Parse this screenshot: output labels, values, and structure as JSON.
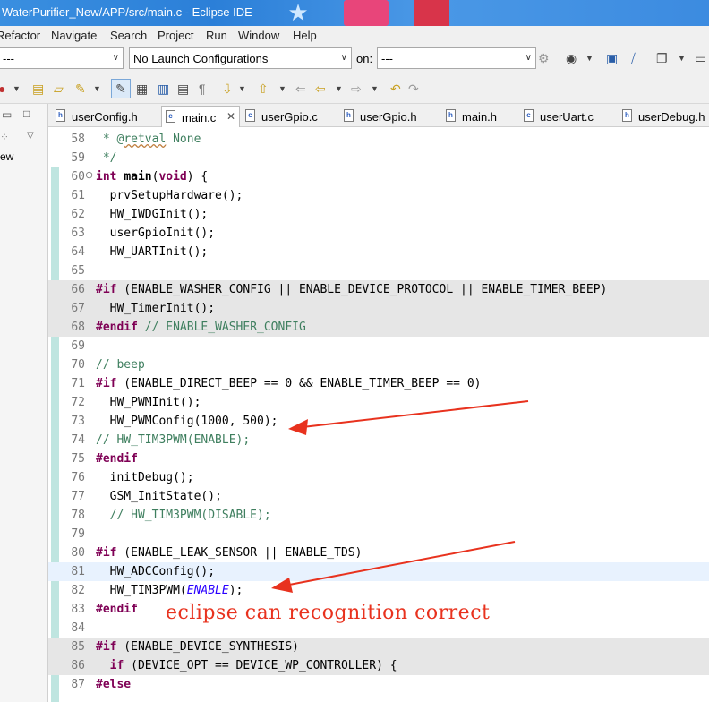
{
  "window": {
    "title": "WaterPurifier_New/APP/src/main.c - Eclipse IDE"
  },
  "menu": [
    "Refactor",
    "Navigate",
    "Search",
    "Project",
    "Run",
    "Window",
    "Help"
  ],
  "toolbar": {
    "launch_mode_value": "---",
    "launch_config_value": "No Launch Configurations",
    "on_label": "on:",
    "launch_target_value": "---"
  },
  "left_view": {
    "label": "ew"
  },
  "tabs": [
    {
      "label": "userConfig.h",
      "icon": "h-file-icon",
      "active": false
    },
    {
      "label": "main.c",
      "icon": "c-file-icon",
      "active": true
    },
    {
      "label": "userGpio.c",
      "icon": "c-file-icon",
      "active": false
    },
    {
      "label": "userGpio.h",
      "icon": "h-file-icon",
      "active": false
    },
    {
      "label": "main.h",
      "icon": "h-file-icon",
      "active": false
    },
    {
      "label": "userUart.c",
      "icon": "c-file-icon",
      "active": false
    },
    {
      "label": "userDebug.h",
      "icon": "h-file-icon",
      "active": false
    }
  ],
  "code_lines": [
    {
      "num": "58",
      "text": " * @retval None"
    },
    {
      "num": "59",
      "text": " */"
    },
    {
      "num": "60",
      "text": "int main(void) {"
    },
    {
      "num": "61",
      "text": "  prvSetupHardware();"
    },
    {
      "num": "62",
      "text": "  HW_IWDGInit();"
    },
    {
      "num": "63",
      "text": "  userGpioInit();"
    },
    {
      "num": "64",
      "text": "  HW_UARTInit();"
    },
    {
      "num": "65",
      "text": ""
    },
    {
      "num": "66",
      "text": "#if (ENABLE_WASHER_CONFIG || ENABLE_DEVICE_PROTOCOL || ENABLE_TIMER_BEEP)"
    },
    {
      "num": "67",
      "text": "  HW_TimerInit();"
    },
    {
      "num": "68",
      "text": "#endif // ENABLE_WASHER_CONFIG"
    },
    {
      "num": "69",
      "text": ""
    },
    {
      "num": "70",
      "text": "// beep"
    },
    {
      "num": "71",
      "text": "#if (ENABLE_DIRECT_BEEP == 0 && ENABLE_TIMER_BEEP == 0)"
    },
    {
      "num": "72",
      "text": "  HW_PWMInit();"
    },
    {
      "num": "73",
      "text": "  HW_PWMConfig(1000, 500);"
    },
    {
      "num": "74",
      "text": "// HW_TIM3PWM(ENABLE);"
    },
    {
      "num": "75",
      "text": "#endif"
    },
    {
      "num": "76",
      "text": "  initDebug();"
    },
    {
      "num": "77",
      "text": "  GSM_InitState();"
    },
    {
      "num": "78",
      "text": "  // HW_TIM3PWM(DISABLE);"
    },
    {
      "num": "79",
      "text": ""
    },
    {
      "num": "80",
      "text": "#if (ENABLE_LEAK_SENSOR || ENABLE_TDS)"
    },
    {
      "num": "81",
      "text": "  HW_ADCConfig();"
    },
    {
      "num": "82",
      "text": "  HW_TIM3PWM(ENABLE);"
    },
    {
      "num": "83",
      "text": "#endif"
    },
    {
      "num": "84",
      "text": ""
    },
    {
      "num": "85",
      "text": "#if (ENABLE_DEVICE_SYNTHESIS)"
    },
    {
      "num": "86",
      "text": "  if (DEVICE_OPT == DEVICE_WP_CONTROLLER) {"
    },
    {
      "num": "87",
      "text": "#else"
    }
  ],
  "annotation": {
    "text": "eclipse can recognition correct",
    "color": "#e8321e"
  },
  "colors": {
    "keyword": "#7f0055",
    "comment": "#3f7f5f",
    "constant": "#2a00ff",
    "inactive_block": "#e6e6e6",
    "current_line": "#e8f2fe"
  }
}
